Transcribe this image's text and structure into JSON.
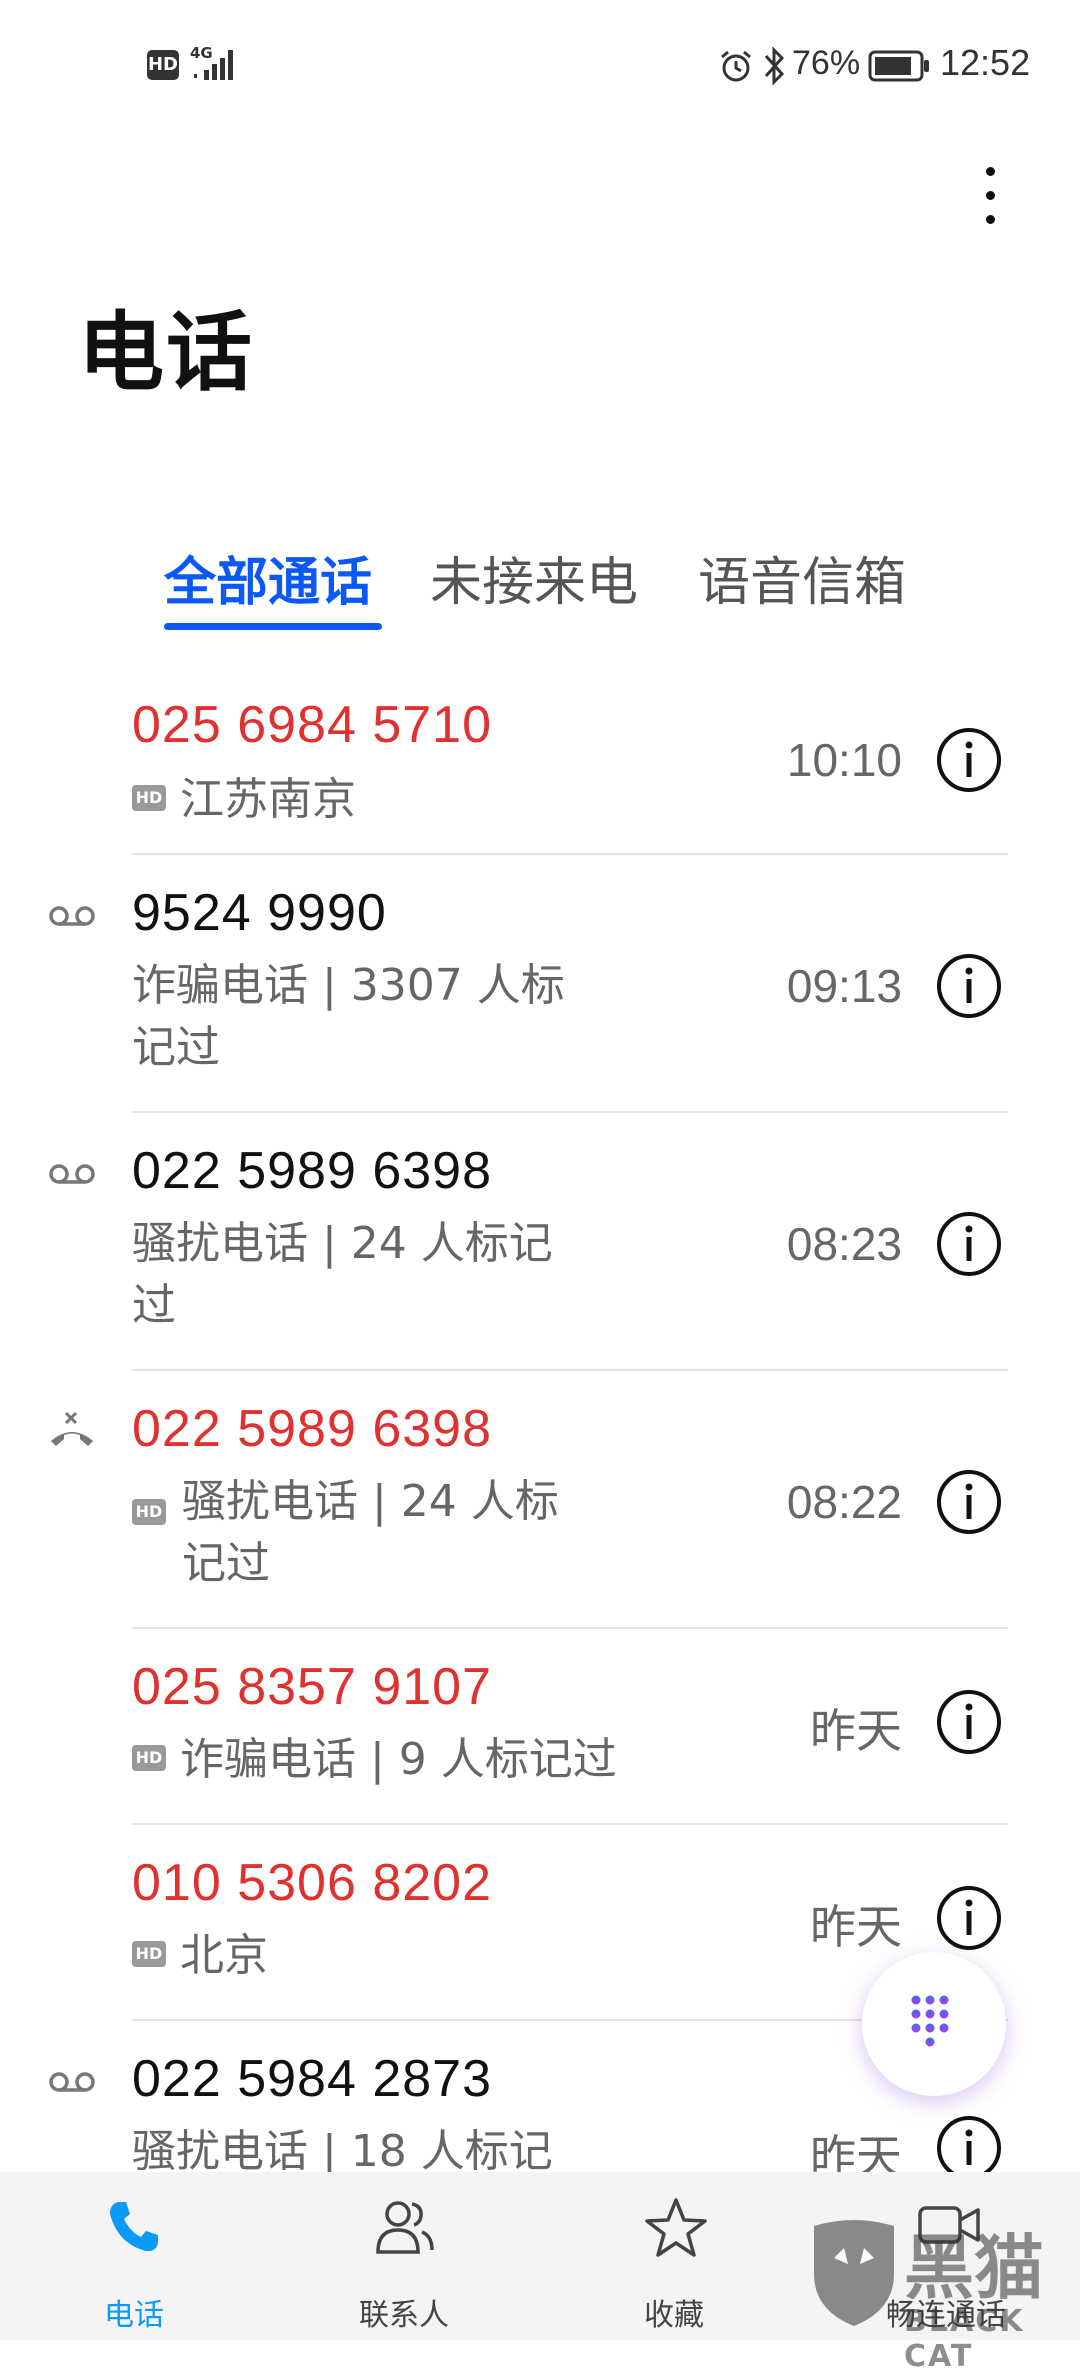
{
  "status_bar": {
    "hd": "HD",
    "network": "4G",
    "battery_percent": "76%",
    "time": "12:52"
  },
  "header": {
    "title": "电话"
  },
  "tabs": [
    {
      "label": "全部通话",
      "active": true
    },
    {
      "label": "未接来电",
      "active": false
    },
    {
      "label": "语音信箱",
      "active": false
    }
  ],
  "calls": [
    {
      "number": "025 6984 5710",
      "number_color": "red",
      "hd": "HD",
      "subtitle": "江苏南京",
      "time": "10:10",
      "icon": "none"
    },
    {
      "number": "9524 9990",
      "number_color": "black",
      "subtitle_line1": "诈骗电话 | 3307 人标",
      "subtitle_line2": "记过",
      "time": "09:13",
      "icon": "voicemail-icon"
    },
    {
      "number": "022 5989 6398",
      "number_color": "black",
      "subtitle_line1": "骚扰电话 | 24 人标记",
      "subtitle_line2": "过",
      "time": "08:23",
      "icon": "voicemail-icon"
    },
    {
      "number": "022 5989 6398",
      "number_color": "red",
      "hd": "HD",
      "subtitle_line1": "骚扰电话 | 24 人标",
      "subtitle_line2": "记过",
      "time": "08:22",
      "icon": "missed-call-icon"
    },
    {
      "number": "025 8357 9107",
      "number_color": "red",
      "hd": "HD",
      "subtitle": "诈骗电话 | 9 人标记过",
      "time": "昨天",
      "icon": "none"
    },
    {
      "number": "010 5306 8202",
      "number_color": "red",
      "hd": "HD",
      "subtitle": "北京",
      "time": "昨天",
      "icon": "none"
    },
    {
      "number": "022 5984 2873",
      "number_color": "black",
      "subtitle": "骚扰电话 | 18 人标记",
      "time": "昨天",
      "icon": "voicemail-icon"
    }
  ],
  "bottom_nav": [
    {
      "label": "电话",
      "icon": "phone-icon",
      "active": true
    },
    {
      "label": "联系人",
      "icon": "contacts-icon",
      "active": false
    },
    {
      "label": "收藏",
      "icon": "star-icon",
      "active": false
    },
    {
      "label": "畅连通话",
      "icon": "video-call-icon",
      "active": false
    }
  ],
  "watermark": {
    "brand": "黑猫",
    "brand_en": "BLACK CAT"
  },
  "colors": {
    "accent": "#0a59f7",
    "missed": "#e0312f",
    "nav_active": "#0a9bf7"
  }
}
